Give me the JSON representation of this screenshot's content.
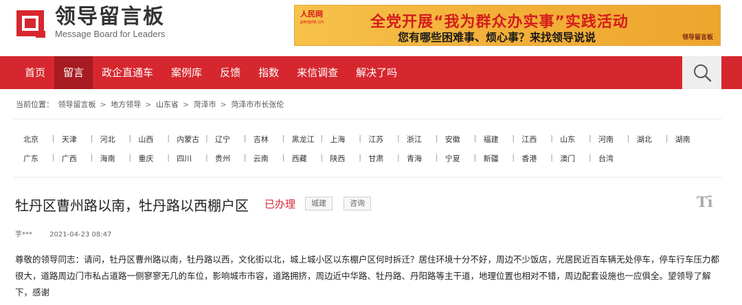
{
  "logo": {
    "title_cn": "领导留言板",
    "title_en": "Message Board for Leaders"
  },
  "banner": {
    "people_logo": "人民网",
    "people_url": "people.cn",
    "line1": "全党开展“我为群众办实事”实践活动",
    "line2": "您有哪些困难事、烦心事？来找领导说说",
    "brand": "领导留言板"
  },
  "nav": {
    "items": [
      {
        "label": "首页"
      },
      {
        "label": "留言"
      },
      {
        "label": "政企直通车"
      },
      {
        "label": "案例库"
      },
      {
        "label": "反馈"
      },
      {
        "label": "指数"
      },
      {
        "label": "来信调查"
      },
      {
        "label": "解决了吗"
      }
    ],
    "active_index": 1
  },
  "breadcrumb": {
    "prefix": "当前位置：",
    "items": [
      "领导留言板",
      "地方领导",
      "山东省",
      "菏泽市",
      "菏泽市市长张伦"
    ]
  },
  "provinces": {
    "row1": [
      "北京",
      "天津",
      "河北",
      "山西",
      "内蒙古",
      "辽宁",
      "吉林",
      "黑龙江",
      "上海",
      "江苏",
      "浙江",
      "安徽",
      "福建",
      "江西",
      "山东",
      "河南",
      "湖北",
      "湖南"
    ],
    "row2": [
      "广东",
      "广西",
      "海南",
      "重庆",
      "四川",
      "贵州",
      "云南",
      "西藏",
      "陕西",
      "甘肃",
      "青海",
      "宁夏",
      "新疆",
      "香港",
      "澳门",
      "台湾"
    ]
  },
  "article": {
    "title": "牡丹区曹州路以南，牡丹路以西棚户区",
    "status": "已办理",
    "tags": [
      "城建",
      "咨询"
    ],
    "font_toggle": "Tī",
    "author": "芋***",
    "date": "2021-04-23 08:47",
    "body": "尊敬的领导同志：请问，牡丹区曹州路以南，牡丹路以西，文化街以北，城上城小区以东棚户区何时拆迁？居住环境十分不好，周边不少饭店，光居民近百车辆无处停车，停车行车压力都很大，道路周边门市私占道路一侧寥寥无几的车位，影响城市市容，道路拥挤，周边近中华路、牡丹路、丹阳路等主干道，地理位置也相对不错，周边配套设施也一应俱全。望领导了解下，感谢"
  },
  "colors": {
    "brand_red": "#d6272f",
    "nav_active": "#a71b22",
    "status_red": "#d6272f"
  }
}
